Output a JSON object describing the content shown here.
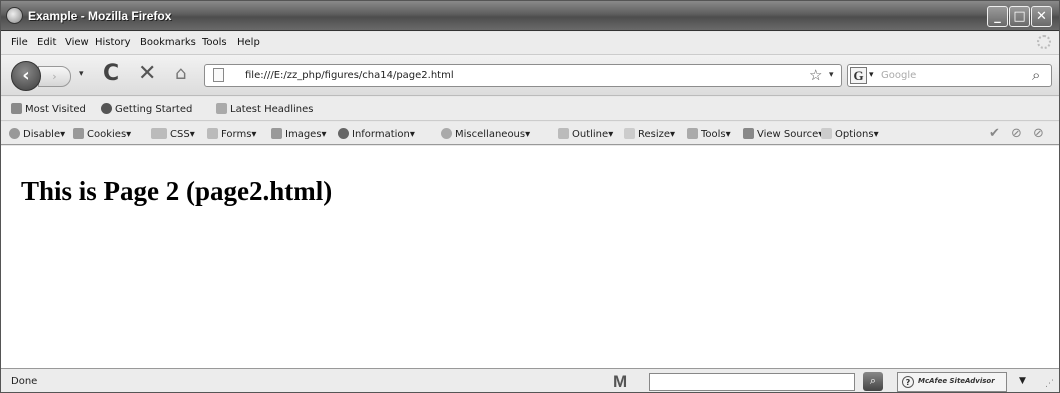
{
  "window": {
    "title": "Example - Mozilla Firefox",
    "controls": {
      "minimize": "_",
      "maximize": "□",
      "close": "✕"
    }
  },
  "menu": [
    "File",
    "Edit",
    "View",
    "History",
    "Bookmarks",
    "Tools",
    "Help"
  ],
  "nav": {
    "back": "‹",
    "forward": "›",
    "dropdown": "▾",
    "reload": "C",
    "stop": "✕",
    "home": "⌂",
    "url": "file:///E:/zz_php/figures/cha14/page2.html",
    "star": "☆",
    "search_engine": "G",
    "search_placeholder": "Google",
    "search_go": "⌕"
  },
  "bookmarks": [
    "Most Visited",
    "Getting Started",
    "Latest Headlines"
  ],
  "devtoolbar": [
    "Disable",
    "Cookies",
    "CSS",
    "Forms",
    "Images",
    "Information",
    "Miscellaneous",
    "Outline",
    "Resize",
    "Tools",
    "View Source",
    "Options"
  ],
  "devtoolbar_end": [
    "✔",
    "⊘",
    "⊘"
  ],
  "page": {
    "heading": "This is Page 2 (page2.html)"
  },
  "status": {
    "text": "Done",
    "m_logo": "M",
    "siteadvisor": "McAfee SiteAdvisor",
    "siteadvisor_q": "?",
    "dropdown": "▼",
    "grip": "⋰"
  },
  "colors": {
    "titlebar": "#5e5e5e",
    "toolbar_bg": "#ececec",
    "content_bg": "#ffffff"
  }
}
